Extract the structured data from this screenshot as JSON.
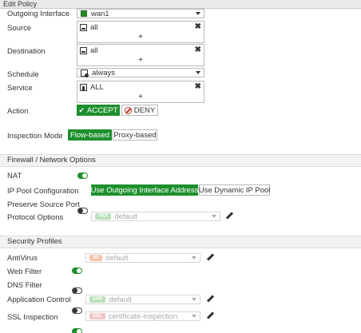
{
  "window": {
    "title": "Edit Policy"
  },
  "form": {
    "outgoing_interface": {
      "label": "Outgoing Interface",
      "value": "wan1"
    },
    "source": {
      "label": "Source",
      "value": "all",
      "add_symbol": "+",
      "remove_symbol": "✖"
    },
    "destination": {
      "label": "Destination",
      "value": "all",
      "add_symbol": "+",
      "remove_symbol": "✖"
    },
    "schedule": {
      "label": "Schedule",
      "value": "always"
    },
    "service": {
      "label": "Service",
      "value": "ALL",
      "add_symbol": "+",
      "remove_symbol": "✖"
    },
    "action": {
      "label": "Action",
      "accept_label": "ACCEPT",
      "deny_label": "DENY",
      "selected": "ACCEPT"
    },
    "inspection_mode": {
      "label": "Inspection Mode",
      "option_flow": "Flow-based",
      "option_proxy": "Proxy-based",
      "selected": "Flow-based"
    }
  },
  "firewall_section": {
    "title": "Firewall / Network Options",
    "nat": {
      "label": "NAT",
      "enabled": true
    },
    "ip_pool": {
      "label": "IP Pool Configuration",
      "option_outgoing": "Use Outgoing Interface Address",
      "option_dynamic": "Use Dynamic IP Pool",
      "selected": "Use Outgoing Interface Address"
    },
    "preserve_source_port": {
      "label": "Preserve Source Port",
      "enabled": false
    },
    "protocol_options": {
      "label": "Protocol Options",
      "badge": "PRX",
      "value": "default"
    }
  },
  "security_section": {
    "title": "Security Profiles",
    "antivirus": {
      "label": "AntiVirus",
      "enabled": true,
      "badge": "AV",
      "value": "default"
    },
    "web_filter": {
      "label": "Web Filter",
      "enabled": false
    },
    "dns_filter": {
      "label": "DNS Filter",
      "enabled": false
    },
    "application_control": {
      "label": "Application Control",
      "enabled": true,
      "badge": "APP",
      "value": "default"
    },
    "ssl_inspection": {
      "label": "SSL Inspection",
      "badge": "SSL",
      "value": "certificate-inspection"
    }
  },
  "colors": {
    "accent_green": "#1e8f2e",
    "deny_red": "#c0392b",
    "section_bg": "#f2f2f2"
  }
}
